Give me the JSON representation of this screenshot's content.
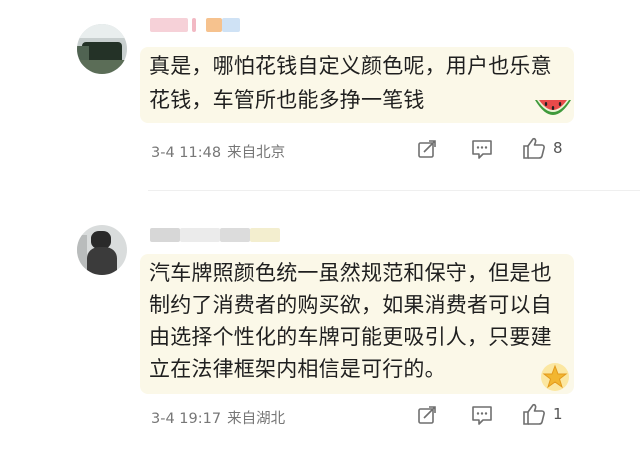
{
  "comments": [
    {
      "text_lines": [
        "真是，哪怕花钱自定义颜色呢，用户也乐意",
        "花钱，车管所也能多挣一笔钱"
      ],
      "time": "3-4 11:48",
      "location": "来自北京",
      "like_count": "8",
      "sticker_icon": "watermelon-icon"
    },
    {
      "text_lines": [
        "汽车牌照颜色统一虽然规范和保守，但是也",
        "制约了消费者的购买欲，如果消费者可以自",
        "由选择个性化的车牌可能更吸引人，只要建",
        "立在法律框架内相信是可行的。"
      ],
      "time": "3-4 19:17",
      "location": "来自湖北",
      "like_count": "1",
      "sticker_icon": "gold-badge-icon"
    }
  ],
  "colors": {
    "bubble": "#fbf8e8",
    "text": "#1f1f1f",
    "meta": "#777777",
    "icon": "#6f6f6f"
  }
}
